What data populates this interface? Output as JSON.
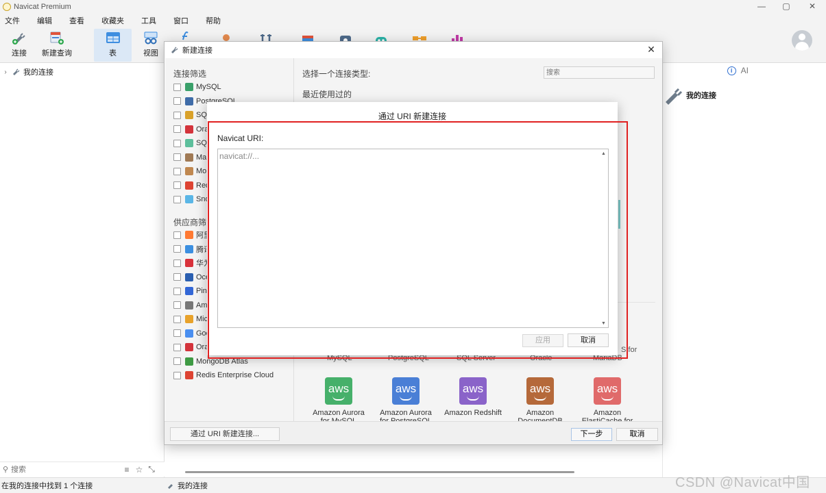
{
  "window": {
    "title": "Navicat Premium",
    "controls": {
      "minimize": "—",
      "maximize": "▢",
      "close": "✕"
    }
  },
  "menu": [
    "文件",
    "编辑",
    "查看",
    "收藏夹",
    "工具",
    "窗口",
    "帮助"
  ],
  "toolbar": {
    "connect_label": "连接",
    "new_query_label": "新建查询",
    "table_label": "表",
    "view_label": "视图"
  },
  "navigator": {
    "connection_group": "我的连接",
    "search_placeholder": "搜索"
  },
  "right_panel": {
    "ai_label": "AI",
    "connection_label": "我的连接"
  },
  "status": {
    "left_text": "在我的连接中找到 1 个连接",
    "mid_text": "我的连接"
  },
  "dialog": {
    "title": "新建连接",
    "close": "✕",
    "filter_heading": "连接筛选",
    "filters": [
      {
        "label": "MySQL",
        "color": "#3aa06a"
      },
      {
        "label": "PostgreSQL",
        "color": "#3f6ca8"
      },
      {
        "label": "SQL",
        "color": "#d9a12a"
      },
      {
        "label": "Ora",
        "color": "#d3343c"
      },
      {
        "label": "SQL",
        "color": "#5dbf9c"
      },
      {
        "label": "Mar",
        "color": "#a07a55"
      },
      {
        "label": "Mor",
        "color": "#c08850"
      },
      {
        "label": "Red",
        "color": "#dd4433"
      },
      {
        "label": "Sno",
        "color": "#5ab6e6"
      }
    ],
    "vendor_heading": "供应商筛",
    "vendors": [
      {
        "label": "阿里",
        "color": "#ff7a33"
      },
      {
        "label": "腾讯",
        "color": "#3c8fe0"
      },
      {
        "label": "华为",
        "color": "#d8323b"
      },
      {
        "label": "Oce",
        "color": "#2b5fb0"
      },
      {
        "label": "Ping",
        "color": "#3367d6"
      },
      {
        "label": "Ama",
        "color": "#777777"
      },
      {
        "label": "Mic",
        "color": "#e8a22b"
      },
      {
        "label": "Goo",
        "color": "#4a8ff0"
      },
      {
        "label": "Ora",
        "color": "#d3343c"
      },
      {
        "label": "MongoDB Atlas",
        "color": "#3f9a44"
      },
      {
        "label": "Redis Enterprise Cloud",
        "color": "#dd4433"
      }
    ],
    "prompt": "选择一个连接类型:",
    "recent_heading": "最近使用过的",
    "search_placeholder": "搜索",
    "partial_row_labels": [
      "MySQL",
      "PostgreSQL",
      "SQL Server",
      "Oracle"
    ],
    "partial_right_label": "S for",
    "partial_right_label2": "MariaDB",
    "aws_tiles": [
      {
        "label": "Amazon Aurora",
        "label2": "for MySQL",
        "color": "#46b06a",
        "icon": "aws"
      },
      {
        "label": "Amazon Aurora",
        "label2": "for PostgreSQL",
        "color": "#4a7fd6",
        "icon": "aws"
      },
      {
        "label": "Amazon Redshift",
        "label2": "",
        "color": "#8a63c9",
        "icon": "aws"
      },
      {
        "label": "Amazon",
        "label2": "DocumentDB",
        "color": "#b5693a",
        "icon": "aws"
      },
      {
        "label": "Amazon",
        "label2": "ElastiCache for",
        "color": "#e06a6a",
        "icon": "aws"
      }
    ],
    "uri_button": "通过 URI 新建连接...",
    "next_button": "下一步",
    "cancel_button": "取消"
  },
  "uri_dialog": {
    "title": "通过 URI 新建连接",
    "label": "Navicat URI:",
    "placeholder": "navicat://...",
    "value": "",
    "apply_button": "应用",
    "cancel_button": "取消",
    "highlight_color": "#e02020"
  },
  "watermark": "CSDN @Navicat中国"
}
